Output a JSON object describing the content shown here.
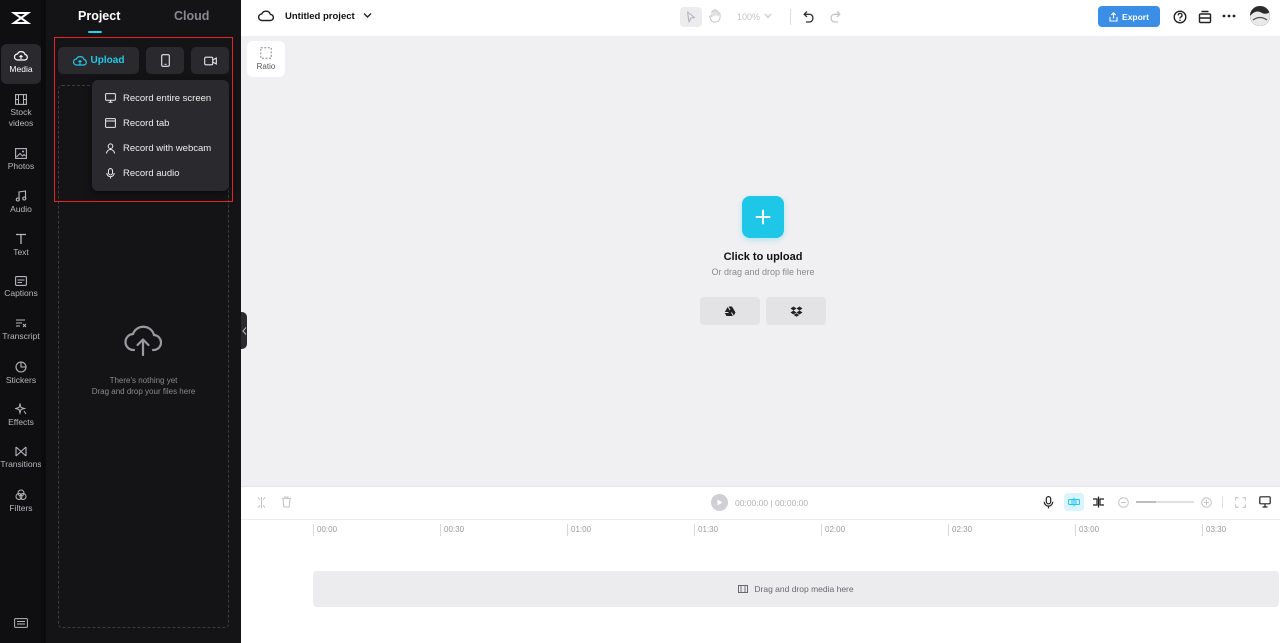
{
  "rail": {
    "items": [
      {
        "label": "Media",
        "icon": "cloud-upload-icon"
      },
      {
        "label": "Stock videos",
        "icon": "film-icon"
      },
      {
        "label": "Photos",
        "icon": "image-icon"
      },
      {
        "label": "Audio",
        "icon": "music-note-icon"
      },
      {
        "label": "Text",
        "icon": "text-t-icon"
      },
      {
        "label": "Captions",
        "icon": "captions-icon"
      },
      {
        "label": "Transcript",
        "icon": "transcript-icon"
      },
      {
        "label": "Stickers",
        "icon": "sticker-icon"
      },
      {
        "label": "Effects",
        "icon": "sparkle-icon"
      },
      {
        "label": "Transitions",
        "icon": "bowtie-icon"
      },
      {
        "label": "Filters",
        "icon": "filter-circles-icon"
      }
    ]
  },
  "panel": {
    "tab_project": "Project",
    "tab_cloud": "Cloud",
    "upload_label": "Upload",
    "empty_line1": "There's nothing yet",
    "empty_line2": "Drag and drop your files here"
  },
  "menu": {
    "items": [
      {
        "label": "Record entire screen",
        "icon": "monitor-icon"
      },
      {
        "label": "Record tab",
        "icon": "browser-tab-icon"
      },
      {
        "label": "Record with webcam",
        "icon": "person-icon"
      },
      {
        "label": "Record audio",
        "icon": "microphone-icon"
      }
    ]
  },
  "topbar": {
    "project_title": "Untitled project",
    "zoom": "100%",
    "export_label": "Export"
  },
  "canvas": {
    "ratio_label": "Ratio",
    "upload_title": "Click to upload",
    "upload_sub": "Or drag and drop file here"
  },
  "timeline": {
    "current_time": "00:00:00",
    "total_time": "00:00:00",
    "ticks": [
      "00:00",
      "00:30",
      "01:00",
      "01:30",
      "02:00",
      "02:30",
      "03:00",
      "03:30"
    ],
    "drop_label": "Drag and drop media here"
  },
  "colors": {
    "accent": "#1ec6e8",
    "export": "#3a8ee6",
    "highlight": "#e5242a"
  }
}
